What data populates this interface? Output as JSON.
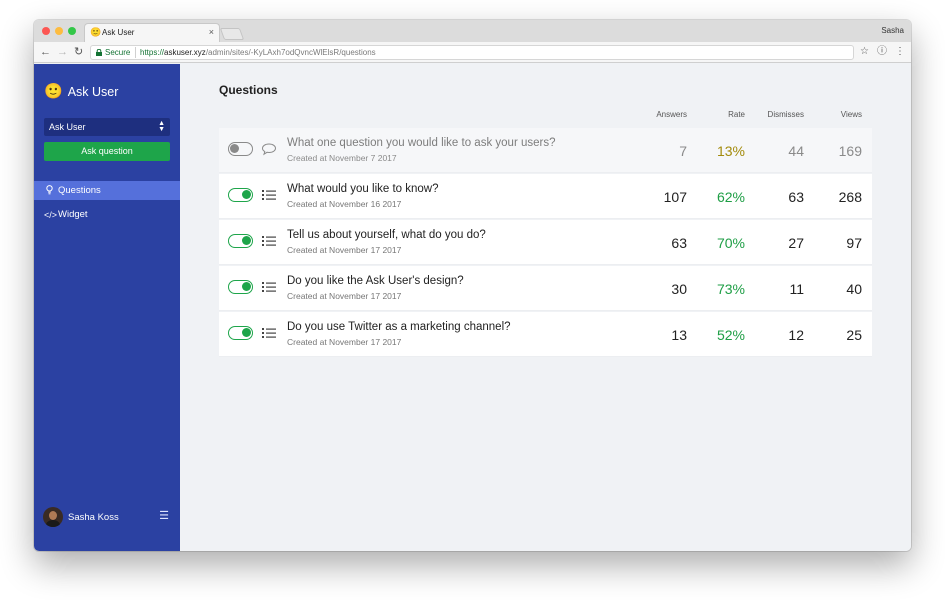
{
  "browser": {
    "tab_title": "Ask User",
    "tab_icon": "🙂",
    "tab_close": "×",
    "profile_name": "Sasha",
    "secure_label": "Secure",
    "url_scheme": "https://",
    "url_host": "askuser.xyz",
    "url_path": "/admin/sites/-KyLAxh7odQvncWlElsR/questions"
  },
  "sidebar": {
    "brand_icon": "🙂",
    "brand_name": "Ask User",
    "site_select_value": "Ask User",
    "ask_button": "Ask question",
    "nav": [
      {
        "label": "Questions",
        "icon": "bulb-icon",
        "active": true
      },
      {
        "label": "Widget",
        "icon": "code-icon",
        "active": false
      }
    ],
    "user_name": "Sasha Koss"
  },
  "main": {
    "title": "Questions",
    "columns": {
      "answers": "Answers",
      "rate": "Rate",
      "dismisses": "Dismisses",
      "views": "Views"
    },
    "questions": [
      {
        "title": "What one question you would like to ask your users?",
        "created": "Created at November 7 2017",
        "enabled": false,
        "type_icon": "speech-bubble-icon",
        "answers": "7",
        "rate": "13%",
        "dismisses": "44",
        "views": "169"
      },
      {
        "title": "What would you like to know?",
        "created": "Created at November 16 2017",
        "enabled": true,
        "type_icon": "list-icon",
        "answers": "107",
        "rate": "62%",
        "dismisses": "63",
        "views": "268"
      },
      {
        "title": "Tell us about yourself, what do you do?",
        "created": "Created at November 17 2017",
        "enabled": true,
        "type_icon": "list-icon",
        "answers": "63",
        "rate": "70%",
        "dismisses": "27",
        "views": "97"
      },
      {
        "title": "Do you like the Ask User's design?",
        "created": "Created at November 17 2017",
        "enabled": true,
        "type_icon": "list-icon",
        "answers": "30",
        "rate": "73%",
        "dismisses": "11",
        "views": "40"
      },
      {
        "title": "Do you use Twitter as a marketing channel?",
        "created": "Created at November 17 2017",
        "enabled": true,
        "type_icon": "list-icon",
        "answers": "13",
        "rate": "52%",
        "dismisses": "12",
        "views": "25"
      }
    ]
  },
  "colors": {
    "sidebar": "#2b41a2",
    "accent_green": "#1ea54a",
    "active_nav": "#5570db",
    "disabled_rate": "#a38b0c"
  }
}
